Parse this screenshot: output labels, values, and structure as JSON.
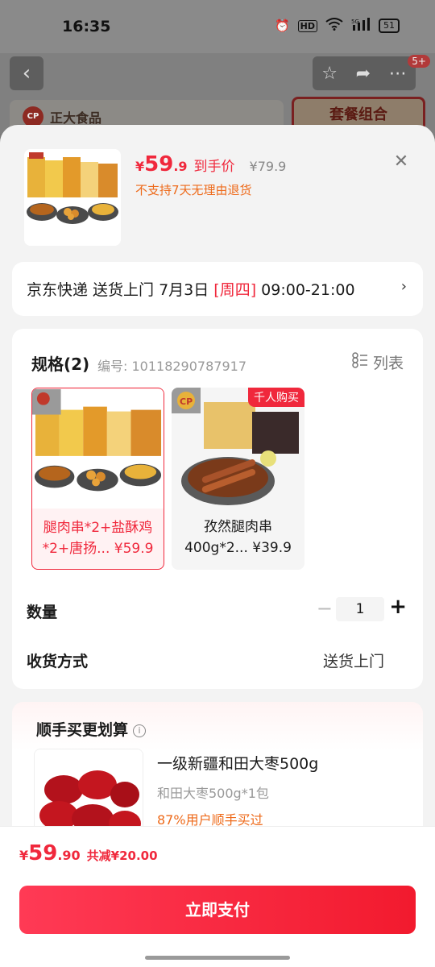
{
  "status_bar": {
    "time": "16:35",
    "hd": "HD",
    "network": "5G",
    "battery": "51"
  },
  "background": {
    "brand_logo": "CP",
    "brand_name": "正大食品",
    "combo_label": "套餐组合",
    "badge": "5+"
  },
  "product": {
    "currency": "¥",
    "price_int": "59",
    "price_dec": ".9",
    "price_tag": "到手价",
    "original_price": "¥79.9",
    "return_notice": "不支持7天无理由退货"
  },
  "delivery": {
    "text_before": "京东快递 送货上门 7月3日 ",
    "weekday": "[周四]",
    "text_after": " 09:00-21:00"
  },
  "spec": {
    "title": "规格(2)",
    "code": "编号: 10118290787917",
    "list_label": "列表",
    "options": [
      {
        "line1": "腿肉串*2+盐酥鸡",
        "line2": "*2+唐扬... ¥59.9",
        "selected": true
      },
      {
        "line1": "孜然腿肉串",
        "line2": "400g*2... ¥39.9",
        "badge": "千人购买",
        "selected": false
      }
    ]
  },
  "quantity": {
    "label": "数量",
    "value": "1",
    "minus": "−",
    "plus": "+"
  },
  "shipping": {
    "label": "收货方式",
    "value": "送货上门"
  },
  "bundle": {
    "title": "顺手买更划算",
    "name": "一级新疆和田大枣500g",
    "sub": "和田大枣500g*1包",
    "percent": "87%用户顺手买过"
  },
  "footer": {
    "currency": "¥",
    "price_int": "59",
    "price_dec": ".90",
    "discount": "共减¥20.00",
    "pay_label": "立即支付"
  },
  "colors": {
    "accent": "#f0283c",
    "orange": "#ee6a1a",
    "sheet_bg": "#f3f3f3"
  }
}
